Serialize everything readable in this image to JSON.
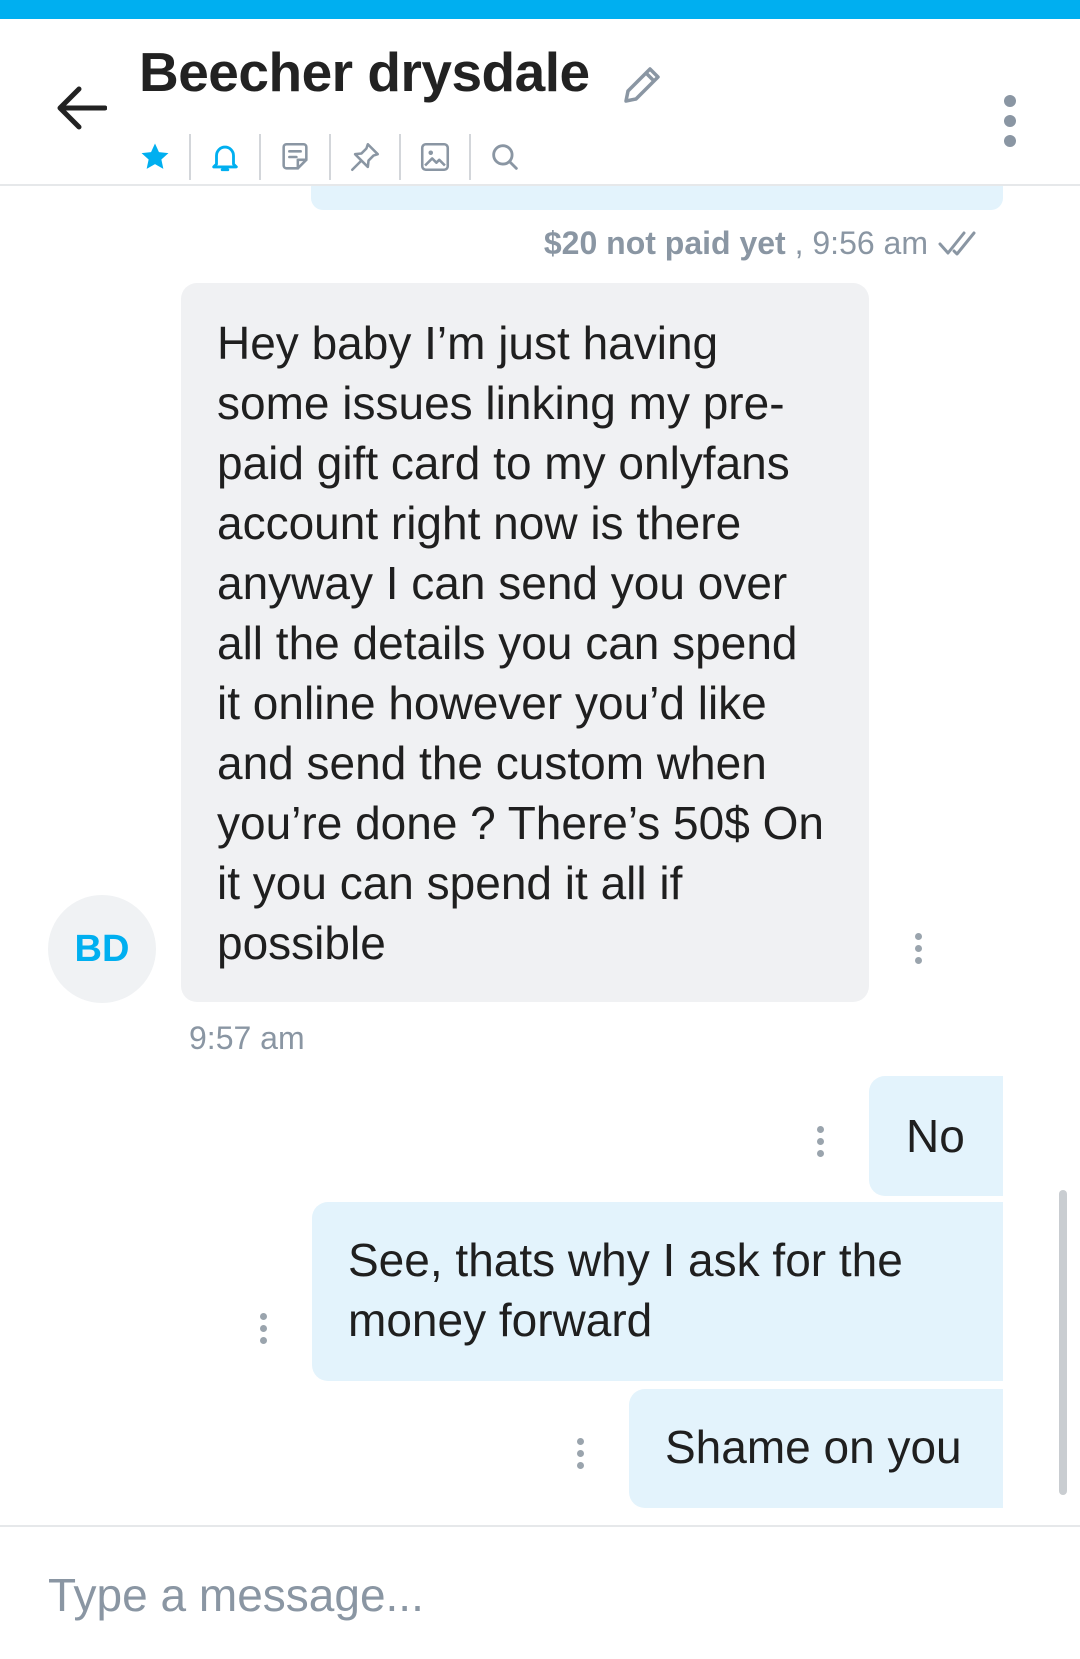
{
  "header": {
    "title": "Beecher drysdale",
    "toolbar_icons": [
      "star-icon",
      "bell-icon",
      "note-icon",
      "pin-icon",
      "image-icon",
      "search-icon"
    ]
  },
  "messages": {
    "previous_outgoing_status": {
      "paid_text": "$20 not paid yet",
      "separator": " , ",
      "time": "9:56 am"
    },
    "incoming": {
      "avatar_initials": "BD",
      "text": "Hey baby I’m just having some issues linking my pre-paid gift card to my onlyfans account right now is there anyway I can send you over all the details you can spend it online however you’d like and send the custom when you’re done ? There’s 50$ On it you can spend it all if possible",
      "time": "9:57 am"
    },
    "outgoing": [
      {
        "text": "No"
      },
      {
        "text": "See, thats why I ask for the money forward"
      },
      {
        "text": "Shame on you"
      }
    ]
  },
  "composer": {
    "placeholder": "Type a message..."
  },
  "colors": {
    "accent": "#00aff0",
    "outgoing_bubble": "#e3f3fc",
    "incoming_bubble": "#f0f1f3",
    "meta_text": "#8a96a3"
  }
}
